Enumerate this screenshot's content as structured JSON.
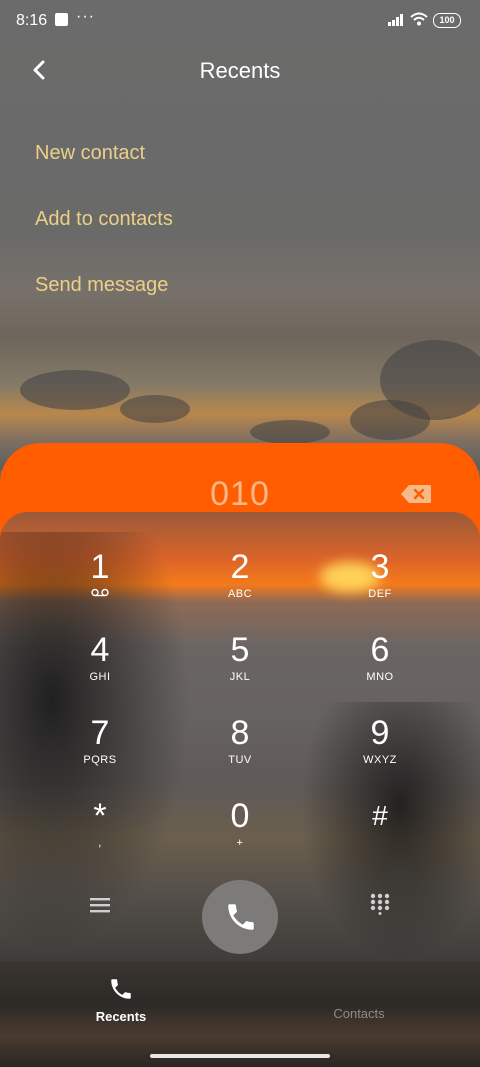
{
  "status_bar": {
    "time": "8:16",
    "more": "···",
    "battery": "100"
  },
  "header": {
    "title": "Recents"
  },
  "menu": [
    {
      "label": "New contact"
    },
    {
      "label": "Add to contacts"
    },
    {
      "label": "Send message"
    }
  ],
  "dialer": {
    "number": "010"
  },
  "keys": [
    {
      "digit": "1",
      "letters": ""
    },
    {
      "digit": "2",
      "letters": "ABC"
    },
    {
      "digit": "3",
      "letters": "DEF"
    },
    {
      "digit": "4",
      "letters": "GHI"
    },
    {
      "digit": "5",
      "letters": "JKL"
    },
    {
      "digit": "6",
      "letters": "MNO"
    },
    {
      "digit": "7",
      "letters": "PQRS"
    },
    {
      "digit": "8",
      "letters": "TUV"
    },
    {
      "digit": "9",
      "letters": "WXYZ"
    },
    {
      "digit": "*",
      "letters": ","
    },
    {
      "digit": "0",
      "letters": "+"
    },
    {
      "digit": "#",
      "letters": ""
    }
  ],
  "nav": {
    "recents": "Recents",
    "contacts": "Contacts"
  },
  "colors": {
    "accent": "#ff5d00",
    "menu_text": "#ecd088"
  }
}
